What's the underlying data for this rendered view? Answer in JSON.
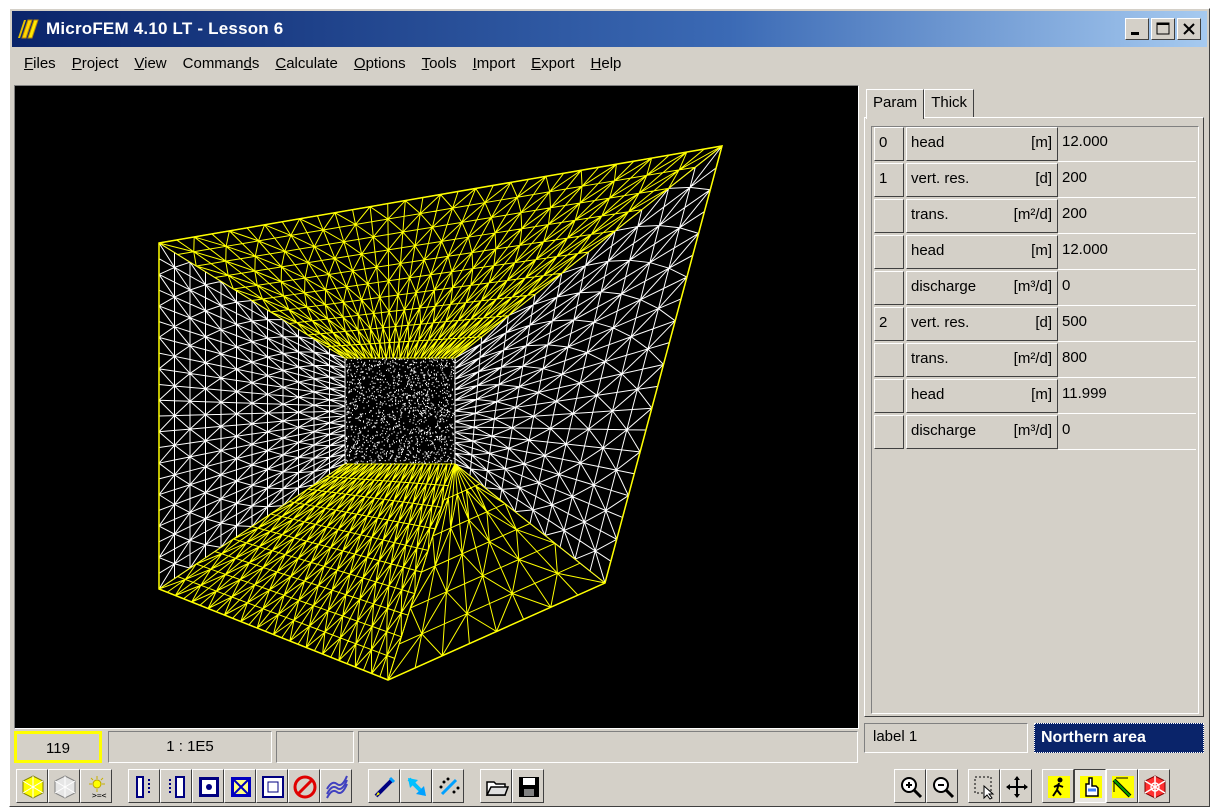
{
  "window": {
    "title": "MicroFEM 4.10 LT - Lesson 6"
  },
  "menu": [
    {
      "label": "Files",
      "key": "F"
    },
    {
      "label": "Project",
      "key": "P"
    },
    {
      "label": "View",
      "key": "V"
    },
    {
      "label": "Commands",
      "key": "d"
    },
    {
      "label": "Calculate",
      "key": "C"
    },
    {
      "label": "Options",
      "key": "O"
    },
    {
      "label": "Tools",
      "key": "T"
    },
    {
      "label": "Import",
      "key": "I"
    },
    {
      "label": "Export",
      "key": "E"
    },
    {
      "label": "Help",
      "key": "H"
    }
  ],
  "panel": {
    "tabs": [
      "Param",
      "Thick"
    ],
    "active_tab": "Param",
    "rows": [
      {
        "idx": "0",
        "name": "head",
        "unit": "[m]",
        "value": "12.000"
      },
      {
        "idx": "1",
        "name": "vert. res.",
        "unit": "[d]",
        "value": "200"
      },
      {
        "idx": "",
        "name": "trans.",
        "unit": "[m²/d]",
        "value": "200"
      },
      {
        "idx": "",
        "name": "head",
        "unit": "[m]",
        "value": "12.000"
      },
      {
        "idx": "",
        "name": "discharge",
        "unit": "[m³/d]",
        "value": "0"
      },
      {
        "idx": "2",
        "name": "vert. res.",
        "unit": "[d]",
        "value": "500"
      },
      {
        "idx": "",
        "name": "trans.",
        "unit": "[m²/d]",
        "value": "800"
      },
      {
        "idx": "",
        "name": "head",
        "unit": "[m]",
        "value": "11.999"
      },
      {
        "idx": "",
        "name": "discharge",
        "unit": "[m³/d]",
        "value": "0"
      }
    ]
  },
  "status": {
    "node_count": "119",
    "scale": "1 : 1E5"
  },
  "label_bar": {
    "label": "label 1",
    "area": "Northern area"
  },
  "colors": {
    "mesh_yellow": "#ffff00",
    "mesh_white": "#ffffff",
    "title_blue": "#0a246a",
    "area_blue": "#0a246a"
  },
  "toolbar_left": [
    "hexagon-mesh-icon",
    "hexagon-mesh-outline-icon",
    "sun-refine-icon",
    "column-bars-icon",
    "column-bars-2-icon",
    "square-dot-icon",
    "square-cross-icon",
    "square-grid-icon",
    "no-entry-icon",
    "contour-lines-icon",
    "pen-draw-icon",
    "arrow-select-icon",
    "dots-brush-icon",
    "open-folder-icon",
    "save-disk-icon"
  ],
  "toolbar_right": [
    "zoom-in-icon",
    "zoom-out-icon",
    "select-region-icon",
    "pan-move-icon",
    "walk-icon",
    "hand-pointer-icon",
    "edit-pencil-icon",
    "hexagon-red-icon"
  ]
}
